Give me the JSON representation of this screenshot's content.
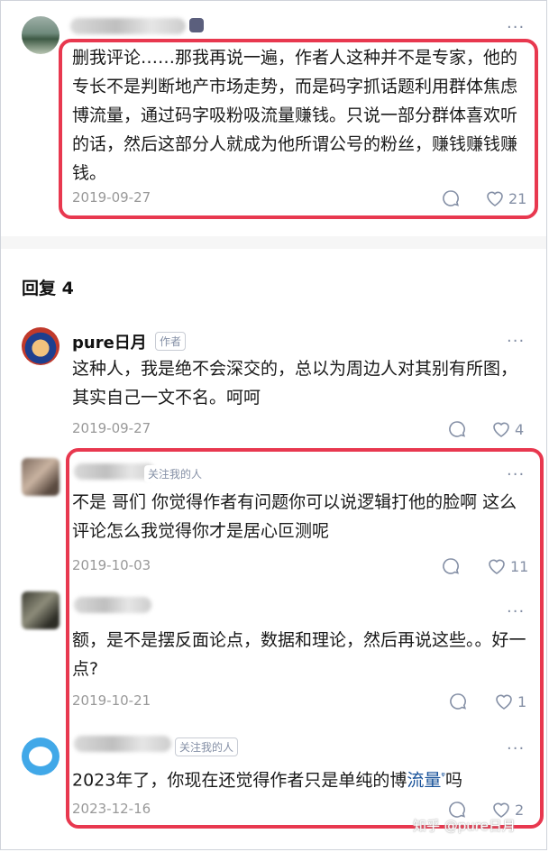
{
  "top_comment": {
    "text": "删我评论……那我再说一遍，作者人这种并不是专家，他的专长不是判断地产市场走势，而是码字抓话题利用群体焦虑博流量，通过码字吸粉吸流量赚钱。只说一部分群体喜欢听的话，然后这部分人就成为他所谓公号的粉丝，赚钱赚钱赚钱。",
    "date": "2019-09-27",
    "likes": "21"
  },
  "replies_header": "回复 4",
  "replies": [
    {
      "author": "pure日月",
      "author_tag": "作者",
      "text": "这种人，我是绝不会深交的，总以为周边人对其别有所图，其实自己一文不名。呵呵",
      "date": "2019-09-27",
      "likes": "4"
    },
    {
      "author_tag": "关注我的人",
      "text": "不是 哥们 你觉得作者有问题你可以说逻辑打他的脸啊 这么评论怎么我觉得你才是居心叵测呢",
      "date": "2019-10-03",
      "likes": "11"
    },
    {
      "text": "额，是不是摆反面论点，数据和理论，然后再说这些。。好一点?",
      "date": "2019-10-21",
      "likes": "1"
    },
    {
      "author_tag": "关注我的人",
      "text_before": "2023年了，你现在还觉得作者只是单纯的博",
      "text_link": "流量",
      "text_after": "吗",
      "date": "2023-12-16",
      "likes": "2"
    }
  ],
  "more_label": "···",
  "watermark": "知乎 @pure日月"
}
